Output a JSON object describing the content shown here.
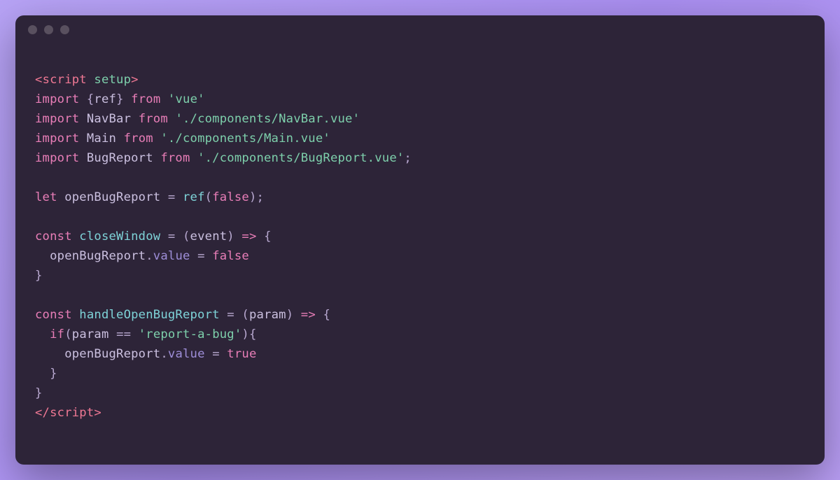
{
  "code": {
    "line1": {
      "openTag": "<",
      "tagName": "script",
      "attr": " setup",
      "closeTag": ">"
    },
    "line2": {
      "import": "import",
      "brace1": " {",
      "name": "ref",
      "brace2": "}",
      "from": " from",
      "string": " 'vue'"
    },
    "line3": {
      "import": "import",
      "name": " NavBar",
      "from": " from",
      "string": " './components/NavBar.vue'"
    },
    "line4": {
      "import": "import",
      "name": " Main",
      "from": " from",
      "string": " './components/Main.vue'"
    },
    "line5": {
      "import": "import",
      "name": " BugReport",
      "from": " from",
      "string": " './components/BugReport.vue'",
      "semi": ";"
    },
    "line7": {
      "let": "let",
      "var": " openBugReport",
      "eq": " =",
      "fn": " ref",
      "paren1": "(",
      "bool": "false",
      "paren2": ")",
      "semi": ";"
    },
    "line9": {
      "const": "const",
      "fnName": " closeWindow",
      "eq": " =",
      "paren1": " (",
      "param": "event",
      "paren2": ")",
      "arrow": " =>",
      "brace": " {"
    },
    "line10": {
      "indent": "  ",
      "var": "openBugReport",
      "dot": ".",
      "prop": "value",
      "eq": " =",
      "bool": " false"
    },
    "line11": {
      "brace": "}"
    },
    "line13": {
      "const": "const",
      "fnName": " handleOpenBugReport",
      "eq": " =",
      "paren1": " (",
      "param": "param",
      "paren2": ")",
      "arrow": " =>",
      "brace": " {"
    },
    "line14": {
      "indent": "  ",
      "if": "if",
      "paren1": "(",
      "var": "param",
      "cmp": " ==",
      "string": " 'report-a-bug'",
      "paren2": ")",
      "brace": "{"
    },
    "line15": {
      "indent": "    ",
      "var": "openBugReport",
      "dot": ".",
      "prop": "value",
      "eq": " =",
      "bool": " true"
    },
    "line16": {
      "indent": "  ",
      "brace": "}"
    },
    "line17": {
      "brace": "}"
    },
    "line18": {
      "openTag": "</",
      "tagName": "script",
      "closeTag": ">"
    }
  }
}
